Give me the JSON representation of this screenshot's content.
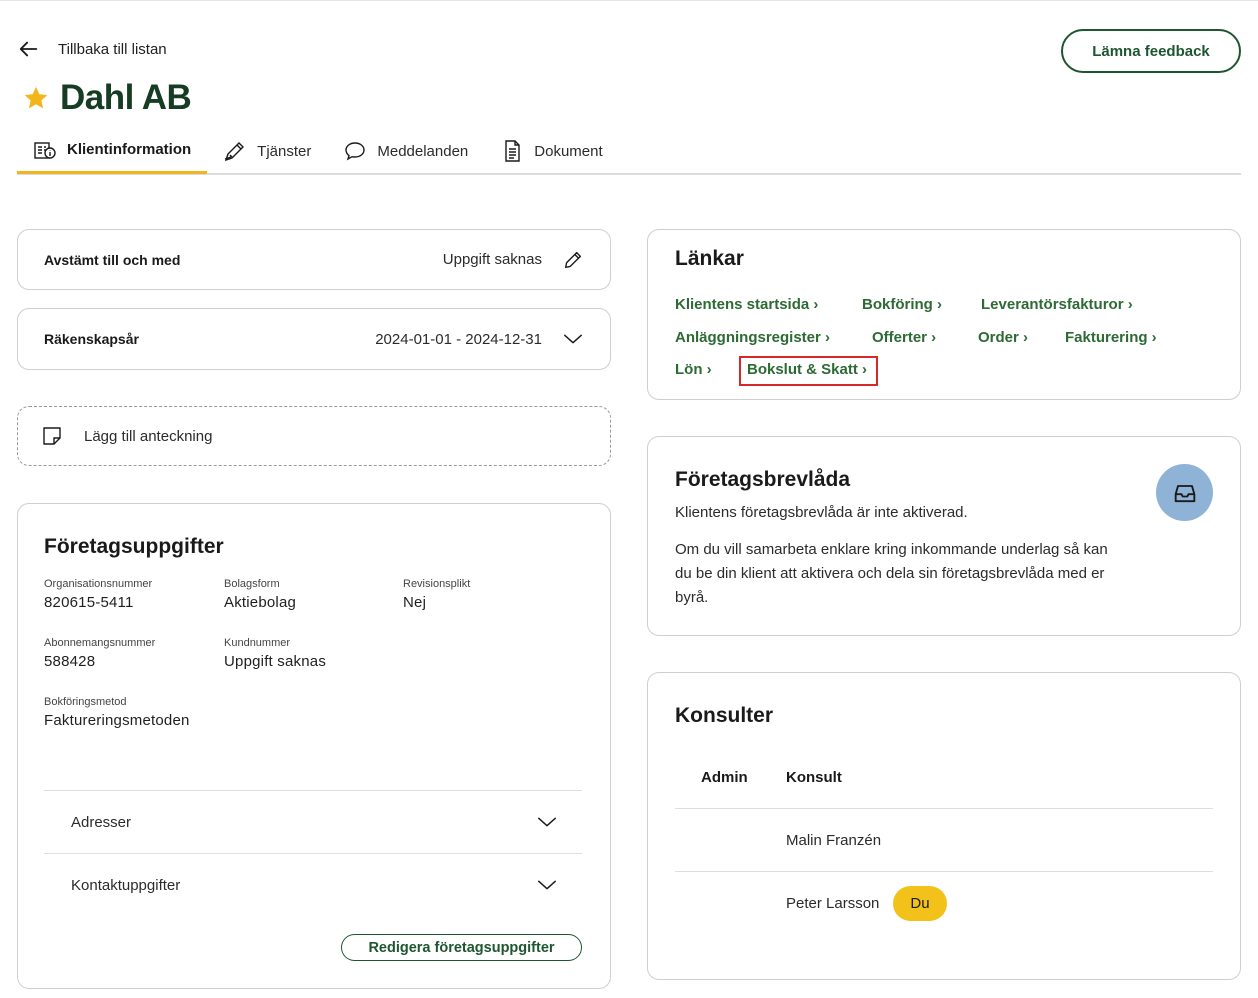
{
  "header": {
    "back_label": "Tillbaka till listan",
    "feedback_label": "Lämna feedback",
    "title": "Dahl AB"
  },
  "tabs": [
    {
      "label": "Klientinformation",
      "icon": "client-info-icon",
      "active": true
    },
    {
      "label": "Tjänster",
      "icon": "pencil-ruler-icon",
      "active": false
    },
    {
      "label": "Meddelanden",
      "icon": "chat-bubble-icon",
      "active": false
    },
    {
      "label": "Dokument",
      "icon": "document-icon",
      "active": false
    }
  ],
  "reconciled": {
    "label": "Avstämt till och med",
    "value": "Uppgift saknas"
  },
  "fiscal_year": {
    "label": "Räkenskapsår",
    "value": "2024-01-01 - 2024-12-31"
  },
  "add_note": {
    "label": "Lägg till anteckning"
  },
  "company": {
    "title": "Företagsuppgifter",
    "fields": [
      {
        "label": "Organisationsnummer",
        "value": "820615-5411"
      },
      {
        "label": "Bolagsform",
        "value": "Aktiebolag"
      },
      {
        "label": "Revisionsplikt",
        "value": "Nej"
      },
      {
        "label": "Abonnemangsnummer",
        "value": "588428"
      },
      {
        "label": "Kundnummer",
        "value": "Uppgift saknas"
      },
      {
        "label": "Bokföringsmetod",
        "value": "Faktureringsmetoden"
      }
    ],
    "accordions": [
      "Adresser",
      "Kontaktuppgifter"
    ],
    "edit_label": "Redigera företagsuppgifter"
  },
  "links": {
    "title": "Länkar",
    "items": [
      "Klientens startsida ›",
      "Bokföring ›",
      "Leverantörsfakturor ›",
      "Anläggningsregister ›",
      "Offerter ›",
      "Order ›",
      "Fakturering ›",
      "Lön ›",
      "Bokslut & Skatt ›"
    ],
    "highlighted": "Bokslut & Skatt ›"
  },
  "mailbox": {
    "title": "Företagsbrevlåda",
    "status": "Klientens företagsbrevlåda är inte aktiverad.",
    "description_lines": [
      "Om du vill samarbeta enklare kring inkommande underlag så kan",
      "du be din klient att aktivera och dela sin företagsbrevlåda med er",
      "byrå."
    ],
    "icon": "inbox-icon"
  },
  "consultants": {
    "title": "Konsulter",
    "headers": [
      "Admin",
      "Konsult"
    ],
    "rows": [
      {
        "admin": "",
        "name": "Malin Franzén",
        "badge": ""
      },
      {
        "admin": "",
        "name": "Peter Larsson",
        "badge": "Du"
      }
    ]
  },
  "colors": {
    "brand_green": "#1e5631",
    "link_green": "#2d6a34",
    "accent_yellow": "#f2b51b",
    "mailbox_blue": "#8fb3d6",
    "highlight_red": "#d62828"
  }
}
